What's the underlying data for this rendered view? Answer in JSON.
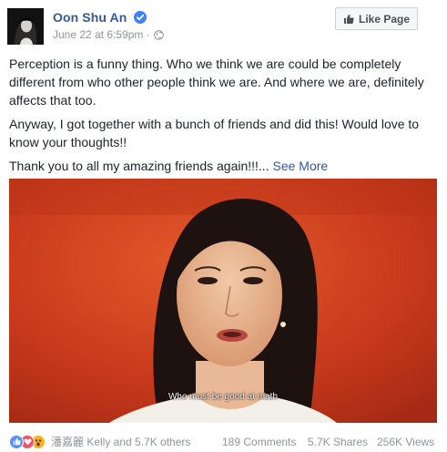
{
  "post": {
    "author": "Oon Shu An",
    "timestamp": "June 22 at 6:59pm",
    "separator": "·",
    "privacy_icon": "globe-icon",
    "verified_icon": "verified-badge-icon",
    "like_page_label": "Like Page",
    "paragraphs": [
      "Perception is a funny thing. Who we think we are could be completely different from who other people think we are. And where we are, definitely affects that too.",
      "Anyway, I got together with a bunch of friends and did this! Would love to know your thoughts!!"
    ],
    "last_paragraph": "Thank you to all my amazing friends again!!!...",
    "see_more": "See More"
  },
  "video": {
    "caption": "Who must be good at math"
  },
  "footer": {
    "reaction_icons": [
      "like-icon",
      "love-icon",
      "wow-icon"
    ],
    "reaction_names": "潘嘉麗 Kelly and 5.7K others",
    "comments": "189 Comments",
    "shares": "5.7K Shares",
    "views": "256K Views"
  },
  "colors": {
    "link": "#365899",
    "meta": "#90949c",
    "text": "#1d2129",
    "video_bg": "#c93a1e"
  }
}
